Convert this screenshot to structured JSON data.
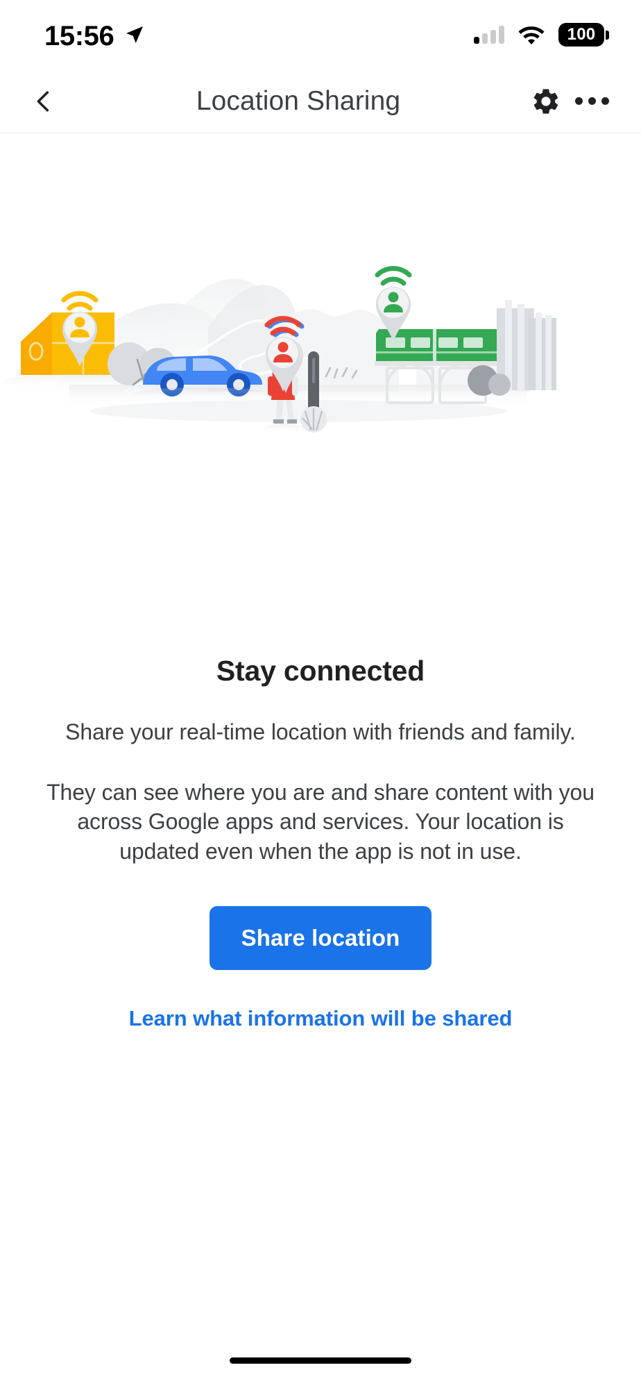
{
  "status_bar": {
    "time": "15:56",
    "location_arrow_icon": "navigation-arrow-icon",
    "signal_icon": "cellular-signal-icon",
    "signal_bars_active": 1,
    "signal_bars_total": 4,
    "wifi_icon": "wifi-icon",
    "battery_level": "100",
    "battery_icon": "battery-full-icon"
  },
  "app_bar": {
    "back_icon": "chevron-left-icon",
    "title": "Location Sharing",
    "settings_icon": "gear-icon",
    "overflow_icon": "more-horizontal-icon"
  },
  "hero": {
    "illustration_name": "location-sharing-illustration",
    "pins": [
      {
        "name": "pin-yellow",
        "color": "#fbbc04"
      },
      {
        "name": "pin-blue",
        "color": "#4285f4"
      },
      {
        "name": "pin-red",
        "color": "#ea4335"
      },
      {
        "name": "pin-green",
        "color": "#34a853"
      }
    ],
    "elements": [
      {
        "name": "house-illustration",
        "color": "#fbbc04"
      },
      {
        "name": "car-illustration",
        "color": "#4285f4"
      },
      {
        "name": "train-illustration",
        "color": "#34a853"
      },
      {
        "name": "pedestrian-illustration",
        "color": "#ea4335"
      },
      {
        "name": "buildings-illustration",
        "color": "#dadce0"
      },
      {
        "name": "tree-illustration",
        "color": "#dadce0"
      }
    ]
  },
  "main": {
    "headline": "Stay connected",
    "paragraph_1": "Share your real-time location with friends and family.",
    "paragraph_2": "They can see where you are and share content with you across Google apps and services. Your location is updated even when the app is not in use.",
    "share_button_label": "Share location",
    "learn_link_label": "Learn what information will be shared"
  },
  "colors": {
    "accent_blue": "#1a73e8",
    "google_yellow": "#fbbc04",
    "google_blue": "#4285f4",
    "google_red": "#ea4335",
    "google_green": "#34a853",
    "text_primary": "#202124",
    "text_secondary": "#3c4043",
    "pin_gray": "#dadce0"
  },
  "system": {
    "home_indicator": "home-indicator"
  }
}
